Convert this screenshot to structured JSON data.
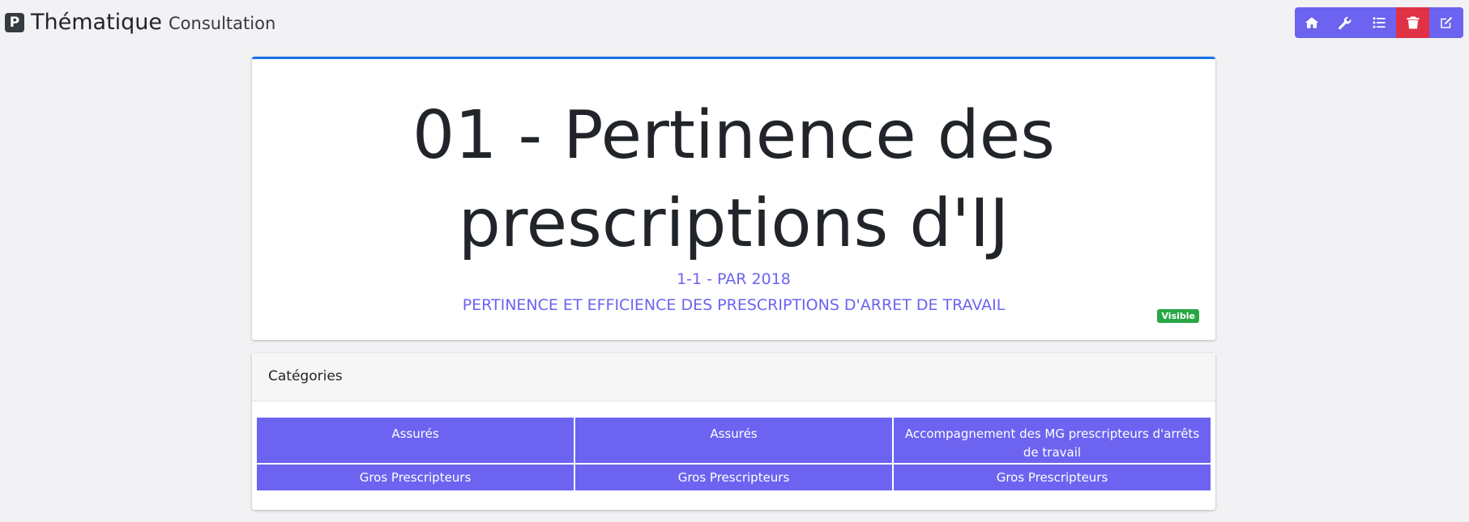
{
  "header": {
    "logo_letter": "P",
    "title": "Thématique",
    "subtitle": "Consultation"
  },
  "toolbar": {
    "buttons": [
      {
        "name": "home-icon"
      },
      {
        "name": "wrench-icon"
      },
      {
        "name": "list-icon"
      },
      {
        "name": "trash-icon",
        "color": "#e03145"
      },
      {
        "name": "edit-icon"
      }
    ],
    "accent": "#6c63f0"
  },
  "theme": {
    "title_line1": "01 - Pertinence des",
    "title_line2": "prescriptions d'IJ",
    "code": "1-1 - PAR 2018",
    "description": "PERTINENCE ET EFFICIENCE DES PRESCRIPTIONS D'ARRET DE TRAVAIL",
    "status": "Visible",
    "status_color": "#28a745",
    "border_color": "#1a73e8"
  },
  "categories": {
    "header": "Catégories",
    "rows": [
      [
        "Assurés",
        "Assurés",
        "Accompagnement des MG prescripteurs d'arrêts de travail"
      ],
      [
        "Gros Prescripteurs",
        "Gros Prescripteurs",
        "Gros Prescripteurs"
      ]
    ]
  }
}
